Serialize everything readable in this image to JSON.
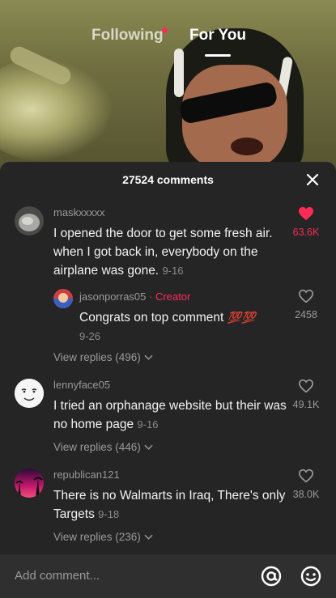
{
  "tabs": {
    "following": "Following",
    "for_you": "For You"
  },
  "panel": {
    "count_label": "27524 comments"
  },
  "comments": [
    {
      "username": "maskxxxxx",
      "text": "I opened the door to get some fresh air. when I got back in, everybody on the airplane was gone.",
      "date": "9-16",
      "likes": "63.6K",
      "liked": true,
      "reply": {
        "username": "jasonporras05",
        "creator_badge": "· Creator",
        "text": "Congrats on top comment",
        "emoji": "💯💯",
        "date": "9-26",
        "likes": "2458"
      },
      "view_replies": "View replies (496)"
    },
    {
      "username": "lennyface05",
      "text": "I tried an orphanage website but their was no home page",
      "date": "9-16",
      "likes": "49.1K",
      "view_replies": "View replies (446)"
    },
    {
      "username": "republican121",
      "text": "There is no Walmarts in Iraq, There's only Targets",
      "date": "9-18",
      "likes": "38.0K",
      "view_replies": "View replies (236)"
    }
  ],
  "input": {
    "placeholder": "Add comment..."
  },
  "colors": {
    "accent": "#fe2c55",
    "panel_bg": "#252525"
  }
}
